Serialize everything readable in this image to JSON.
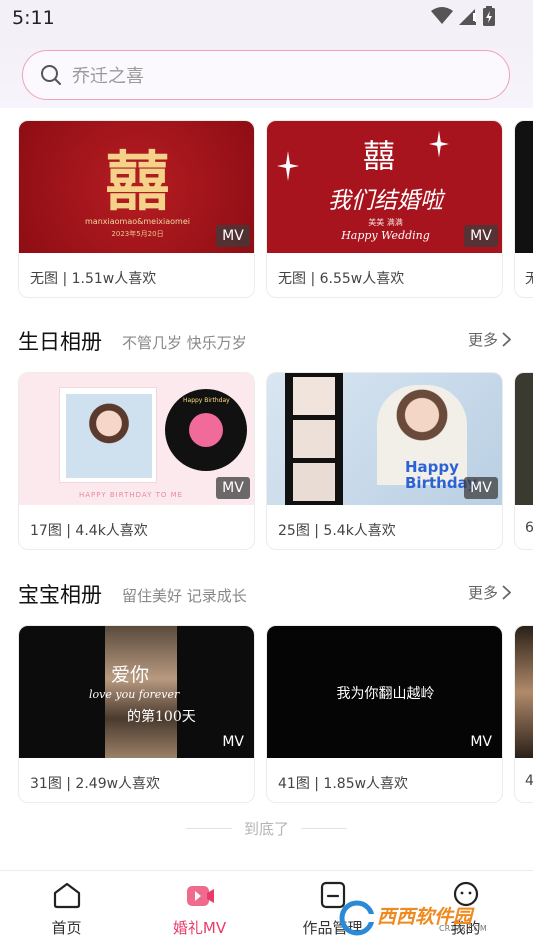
{
  "status_bar": {
    "time": "5:11"
  },
  "search": {
    "placeholder": "乔迁之喜"
  },
  "wedding_cards": [
    {
      "thumb_title": "囍",
      "thumb_small": "manxiaomao&meixiaomei",
      "thumb_date": "2023年5月20日",
      "badge": "MV",
      "info": "无图 | 1.51w人喜欢"
    },
    {
      "thumb_title": "囍",
      "thumb_script": "我们结婚啦",
      "thumb_names": "美美 满满",
      "thumb_caption": "Happy Wedding",
      "badge": "MV",
      "info": "无图 | 6.55w人喜欢"
    }
  ],
  "wedding_partial": {
    "info": "无"
  },
  "birthday_section": {
    "title": "生日相册",
    "subtitle": "不管几岁 快乐万岁",
    "more": "更多",
    "cards": [
      {
        "thumb_caption": "HAPPY BIRTHDAY TO ME",
        "thumb_disc": "Happy Birthday",
        "badge": "MV",
        "info": "17图 | 4.4k人喜欢"
      },
      {
        "thumb_caption": "Happy Birthday",
        "badge": "MV",
        "info": "25图 | 5.4k人喜欢"
      }
    ],
    "partial_info": "6"
  },
  "baby_section": {
    "title": "宝宝相册",
    "subtitle": "留住美好 记录成长",
    "more": "更多",
    "cards": [
      {
        "thumb_line1": "爱你",
        "thumb_script": "love you forever",
        "thumb_line2": "的第100天",
        "badge": "MV",
        "info": "31图 | 2.49w人喜欢"
      },
      {
        "thumb_line1": "我为你翻山越岭",
        "badge": "MV",
        "info": "41图 | 1.85w人喜欢"
      }
    ],
    "partial_info": "4"
  },
  "end_text": "到底了",
  "tabs": [
    {
      "label": "首页",
      "icon": "home-icon"
    },
    {
      "label": "婚礼MV",
      "icon": "video-play-icon",
      "active": true
    },
    {
      "label": "作品管理",
      "icon": "works-icon"
    },
    {
      "label": "我的",
      "icon": "profile-icon"
    }
  ],
  "watermark": {
    "text": "西西软件园",
    "url": "CR173.COM"
  },
  "colors": {
    "accent": "#ea3a6a",
    "wedding_red": "#a8141d",
    "search_border": "#f0a2b8"
  }
}
